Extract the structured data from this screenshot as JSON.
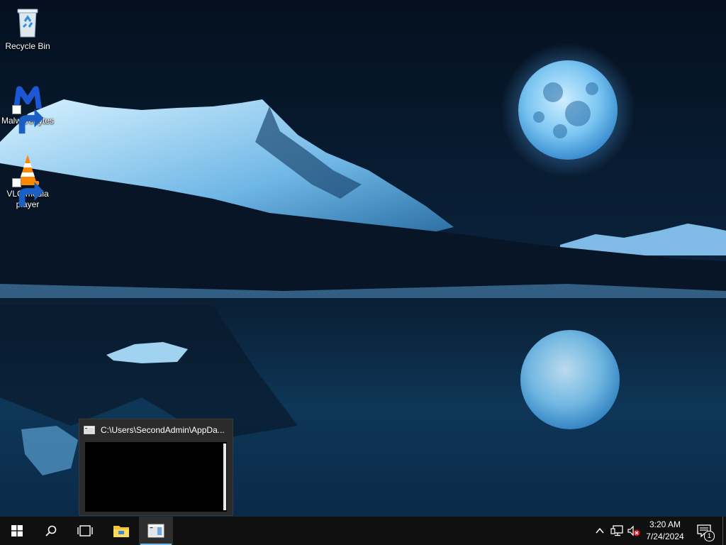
{
  "desktop": {
    "icons": [
      {
        "label": "Recycle Bin",
        "icon": "recycle-bin-icon"
      },
      {
        "label": "Malwarebytes",
        "icon": "malwarebytes-icon"
      },
      {
        "label": "VLC media\nplayer",
        "icon": "vlc-cone-icon"
      }
    ]
  },
  "thumbnail": {
    "title": "C:\\Users\\SecondAdmin\\AppDa..."
  },
  "taskbar": {
    "buttons": [
      "windows-start-icon",
      "search-icon",
      "task-view-icon",
      "file-explorer-icon",
      "terminal-window-icon"
    ],
    "tray": {
      "time": "3:20 AM",
      "date": "7/24/2024",
      "notification_count": "1",
      "icons": [
        "chevron-up-icon",
        "network-icon",
        "volume-muted-icon",
        "action-center-icon"
      ]
    }
  },
  "colors": {
    "taskbar_bg": "#101010",
    "accent": "#76b9ed",
    "wallpaper_blue": "#2a7fc4"
  }
}
